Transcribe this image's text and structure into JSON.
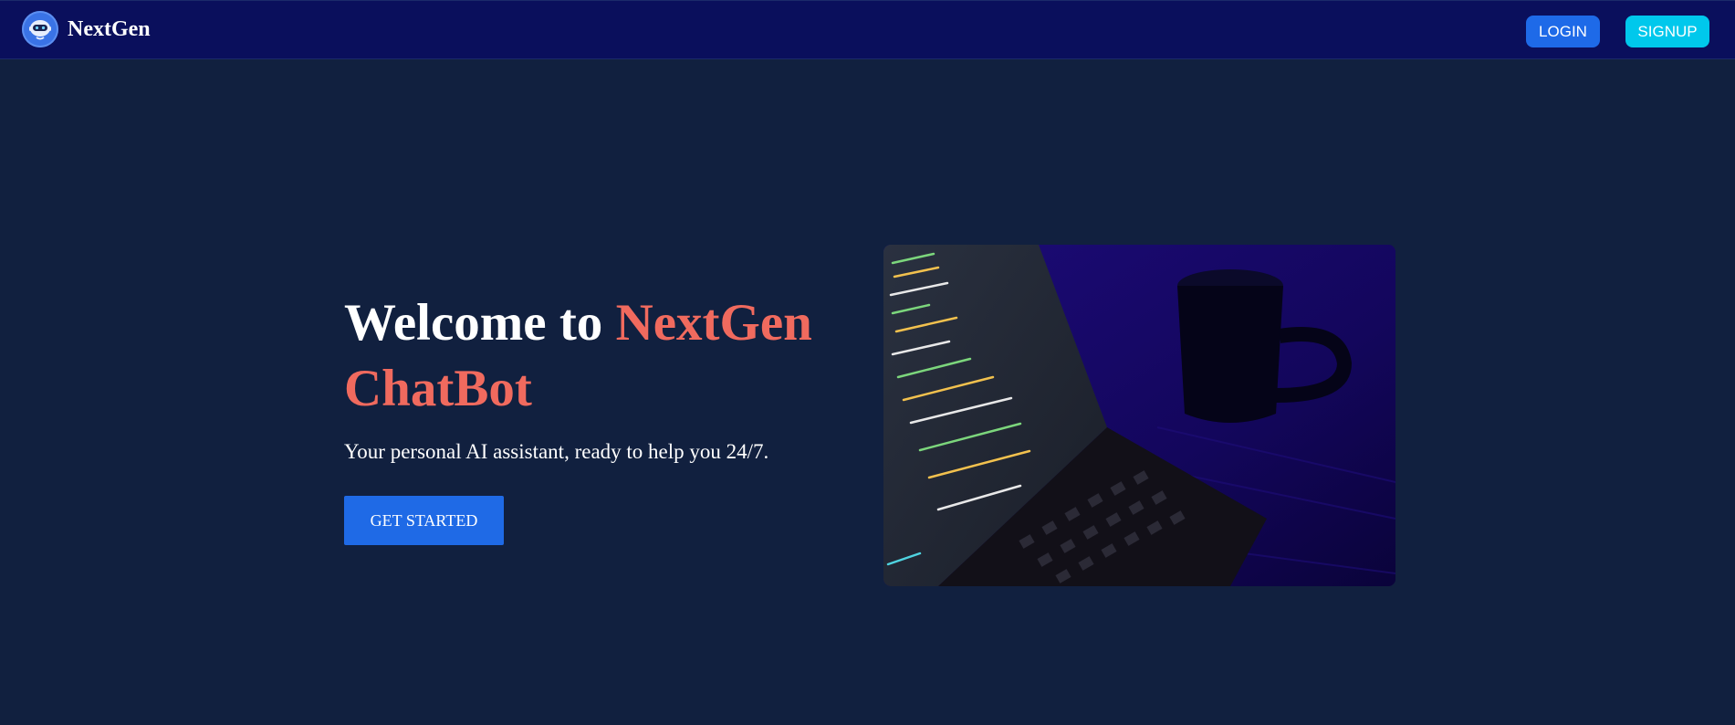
{
  "nav": {
    "brand": "NextGen",
    "login_label": "LOGIN",
    "signup_label": "SIGNUP"
  },
  "hero": {
    "title_part1": "Welcome to ",
    "title_accent": "NextGen ChatBot",
    "subtitle": "Your personal AI assistant, ready to help you 24/7.",
    "cta_label": "GET STARTED"
  },
  "colors": {
    "background": "#11203f",
    "navbar": "#0a0f5c",
    "accent_text": "#f06a5e",
    "primary_button": "#1f6ae6",
    "signup_button": "#00c8ec"
  },
  "icons": {
    "logo": "robot-icon"
  }
}
